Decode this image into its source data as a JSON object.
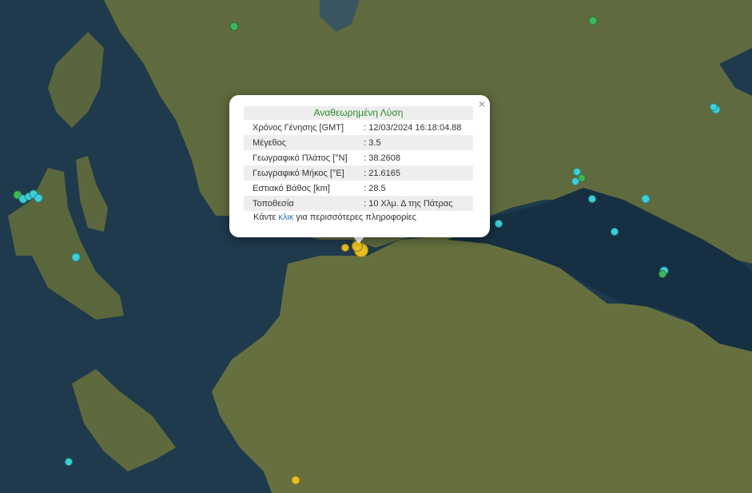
{
  "colors": {
    "sea": "#1f3a4c",
    "land": "#5f6a3e",
    "recent": "#e8c020",
    "cyan": "#3ecfd6",
    "green": "#3fb55a",
    "popup_title": "#2a8a2a",
    "link": "#2676b0"
  },
  "popup": {
    "title": "Αναθεωρημένη Λύση",
    "close": "×",
    "rows": [
      {
        "label": "Χρόνος Γένησης [GMT]",
        "value": ": 12/03/2024 16:18:04.88"
      },
      {
        "label": "Μέγεθος",
        "value": ": 3.5"
      },
      {
        "label": "Γεωγραφικό Πλάτος [°N]",
        "value": ": 38.2608"
      },
      {
        "label": "Γεωγραφικό Μήκος [°E]",
        "value": ": 21.6165"
      },
      {
        "label": "Εστιακό Βάθος [km]",
        "value": ": 28.5"
      },
      {
        "label": "Τοποθεσία",
        "value": ": 10 Χλμ. Δ της Πάτρας"
      }
    ],
    "more_prefix": "Κάντε ",
    "more_link": "κλικ",
    "more_suffix": " για περισσότερες πληροφορίες"
  }
}
